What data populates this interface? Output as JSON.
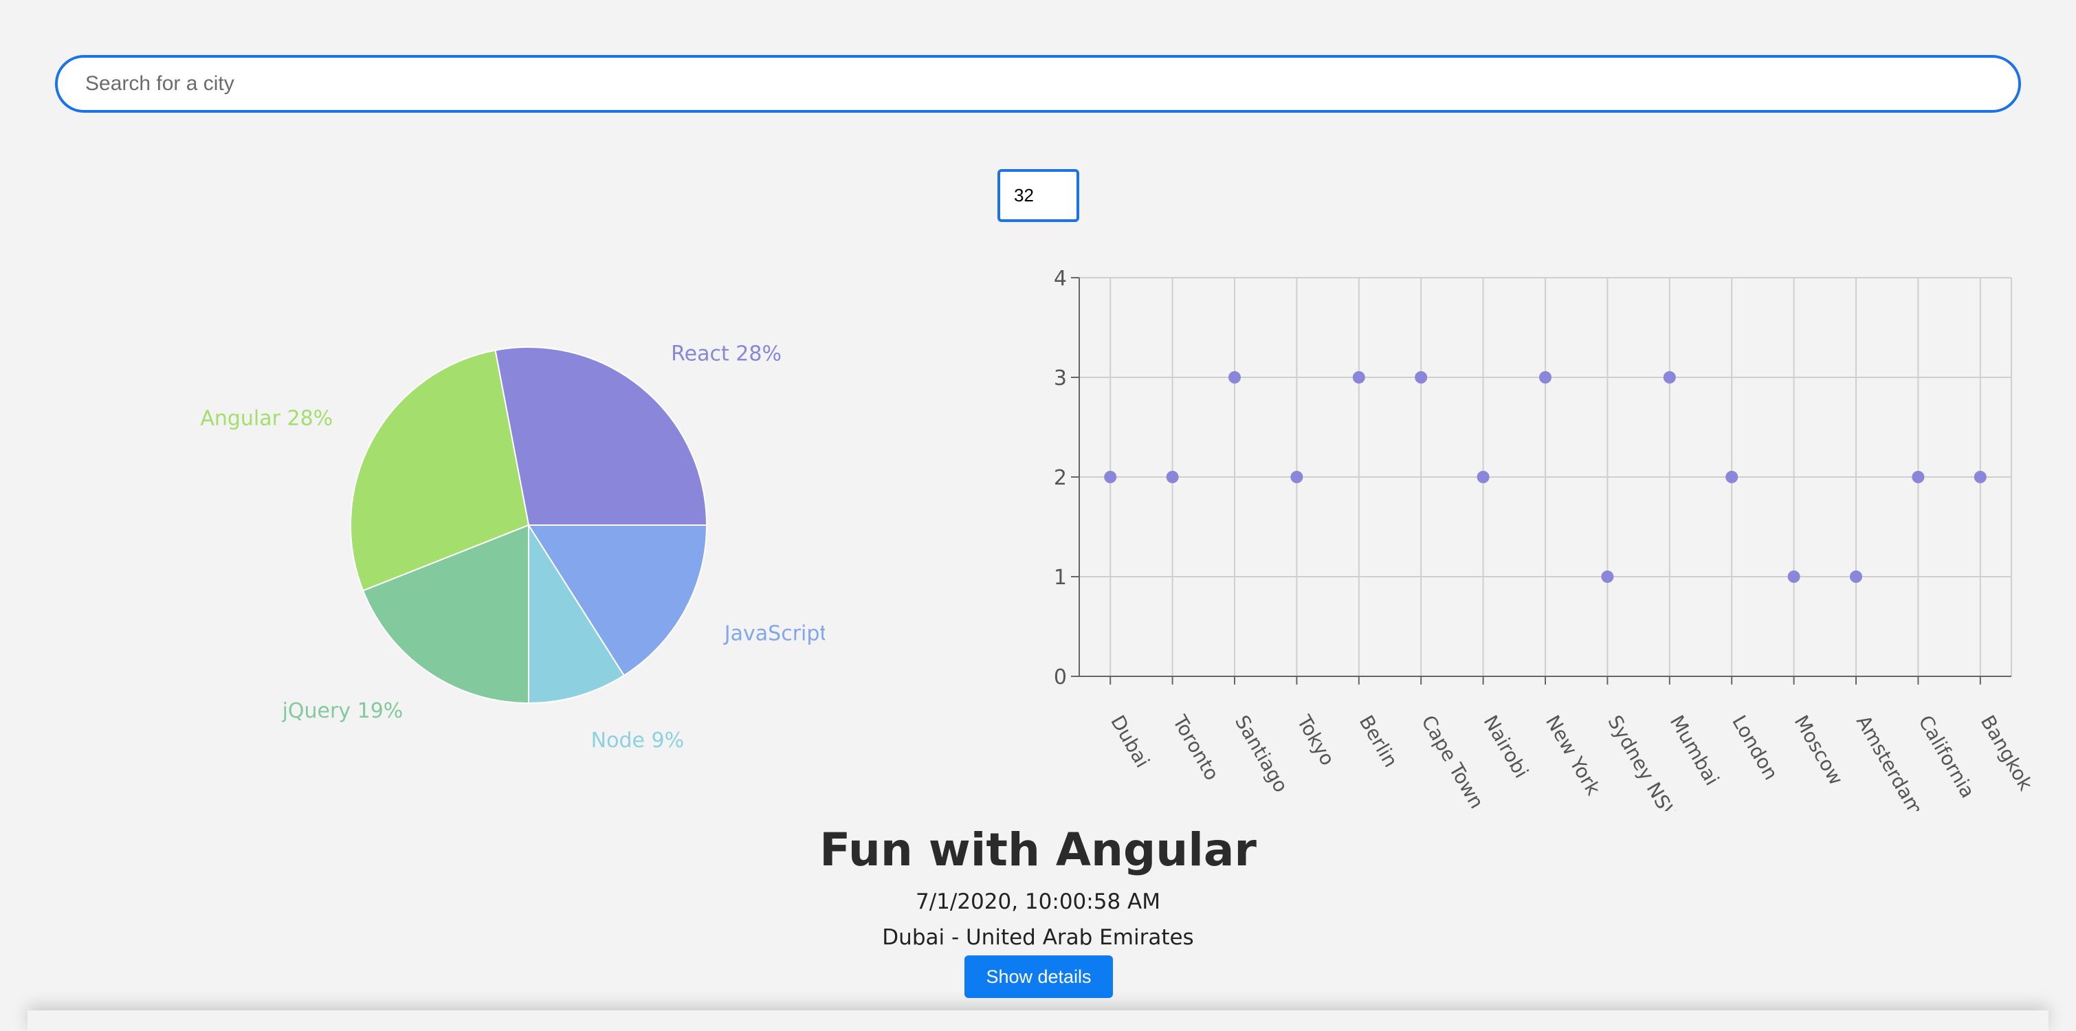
{
  "search": {
    "placeholder": "Search for a city",
    "value": ""
  },
  "number_input": {
    "value": "32"
  },
  "colors": {
    "accent": "#1a73e8",
    "button": "#0d7cf2",
    "scatter_point": "#8a86d9",
    "grid": "#cfcfcf"
  },
  "chart_data": [
    {
      "type": "pie",
      "title": "",
      "slices": [
        {
          "label": "React",
          "value": 28,
          "color": "#8a86d9"
        },
        {
          "label": "Angular",
          "value": 28,
          "color": "#a4de6c"
        },
        {
          "label": "jQuery",
          "value": 19,
          "color": "#82ca9d"
        },
        {
          "label": "Node",
          "value": 9,
          "color": "#8dd1e1"
        },
        {
          "label": "JavaScript",
          "value": 16,
          "color": "#83a6ed"
        }
      ]
    },
    {
      "type": "scatter",
      "title": "",
      "xlabel": "",
      "ylabel": "",
      "ylim": [
        0,
        4
      ],
      "yticks": [
        0,
        1,
        2,
        3,
        4
      ],
      "grid": true,
      "categories": [
        "Dubai",
        "Toronto",
        "Santiago",
        "Tokyo",
        "Berlin",
        "Cape Town",
        "Nairobi",
        "New York",
        "Sydney NSW",
        "Mumbai",
        "London",
        "Moscow",
        "Amsterdam",
        "California",
        "Bangkok"
      ],
      "values": [
        2,
        2,
        3,
        2,
        3,
        3,
        2,
        3,
        1,
        3,
        2,
        1,
        1,
        2,
        2
      ]
    }
  ],
  "main": {
    "title": "Fun with Angular",
    "timestamp": "7/1/2020, 10:00:58 AM",
    "location": "Dubai - United Arab Emirates",
    "details_button": "Show details"
  }
}
